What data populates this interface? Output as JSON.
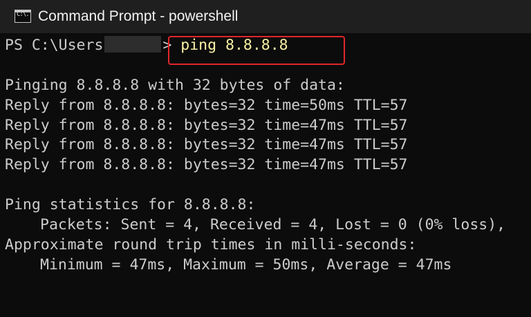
{
  "window": {
    "title": "Command Prompt - powershell",
    "icon": "cmd-icon",
    "icon_text": "C:\\."
  },
  "terminal": {
    "prompt_prefix": "PS C:\\Users",
    "prompt_suffix": ">",
    "command": "ping 8.8.8.8",
    "output": [
      "Pinging 8.8.8.8 with 32 bytes of data:",
      "Reply from 8.8.8.8: bytes=32 time=50ms TTL=57",
      "Reply from 8.8.8.8: bytes=32 time=47ms TTL=57",
      "Reply from 8.8.8.8: bytes=32 time=47ms TTL=57",
      "Reply from 8.8.8.8: bytes=32 time=47ms TTL=57",
      "Ping statistics for 8.8.8.8:",
      "Packets: Sent = 4, Received = 4, Lost = 0 (0% loss),",
      "Approximate round trip times in milli-seconds:",
      "Minimum = 47ms, Maximum = 50ms, Average = 47ms"
    ]
  },
  "colors": {
    "background": "#0c0c0c",
    "titlebar": "#1f1f1f",
    "text": "#cccccc",
    "command_text": "#f9f1a5",
    "highlight_border": "#e0262b"
  }
}
